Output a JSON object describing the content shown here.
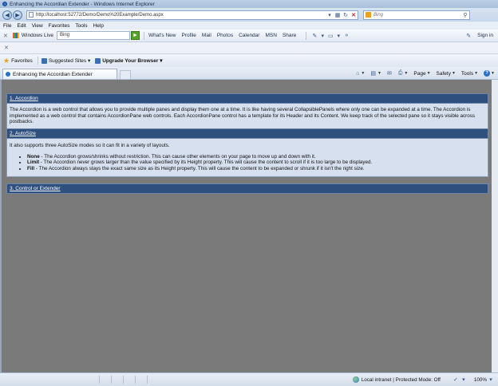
{
  "window": {
    "title": "Enhancing the Accordian Extender - Windows Internet Explorer"
  },
  "address": {
    "url": "http://localhost:52772/Demo/Demo%20Example/Demo.aspx",
    "search_placeholder": "Bing"
  },
  "menu": [
    "File",
    "Edit",
    "View",
    "Favorites",
    "Tools",
    "Help"
  ],
  "windows_live": {
    "label": "Windows Live",
    "search_value": "Bing",
    "links": [
      "What's New",
      "Profile",
      "Mail",
      "Photos",
      "Calendar",
      "MSN",
      "Share"
    ],
    "signin": "Sign in"
  },
  "favorites": {
    "label": "Favorites",
    "suggested": "Suggested Sites ▾",
    "upgrade": "Upgrade Your Browser ▾"
  },
  "tab": {
    "label": "Enhancing the Accordian Extender"
  },
  "tools": {
    "page": "Page",
    "safety": "Safety",
    "tools": "Tools"
  },
  "accordion": {
    "pane1": {
      "header": "1. Accordion",
      "body": "The Accordion is a web control that allows you to provide multiple panes and display them one at a time. It is like having several CollapsiblePanels where only one can be expanded at a time. The Accordion is implemented as a web control that contains AccordionPane web controls. Each AccordionPane control has a template for its Header and its Content. We keep track of the selected pane so it stays visible across postbacks."
    },
    "pane2": {
      "header": "2. AutoSize",
      "intro": "It also supports three AutoSize modes so it can fit in a variety of layouts.",
      "items": [
        {
          "term": "None",
          "text": " - The Accordion grows/shrinks without restriction. This can cause other elements on your page to move up and down with it."
        },
        {
          "term": "Limit",
          "text": " - The Accordion never grows larger than the value specified by its Height property. This will cause the content to scroll if it is too large to be displayed."
        },
        {
          "term": "Fill",
          "text": " - The Accordion always stays the exact same size as its Height property. This will cause the content to be expanded or shrunk if it isn't the right size."
        }
      ]
    },
    "pane3": {
      "header": "3. Control or Extender"
    }
  },
  "status": {
    "zone": "Local intranet | Protected Mode: Off",
    "zoom": "100%"
  }
}
